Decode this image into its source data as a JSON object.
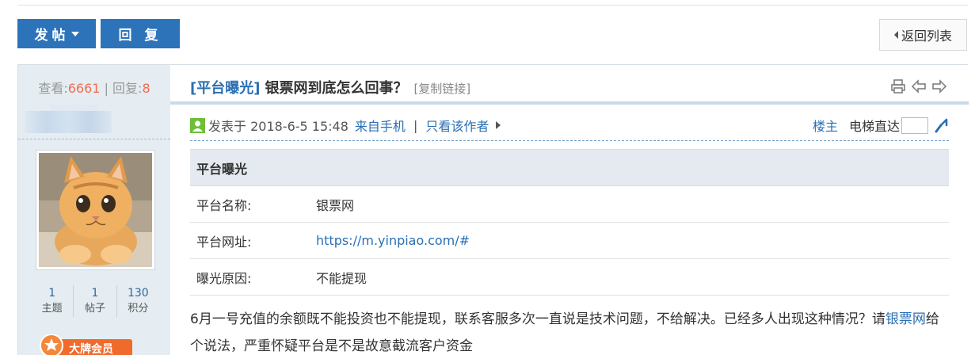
{
  "toolbar": {
    "post_label": "发帖",
    "reply_label": "回 复",
    "back_label": "返回列表"
  },
  "sidebar": {
    "views_label": "查看:",
    "views_value": "6661",
    "divider": "|",
    "replies_label": "回复:",
    "replies_value": "8",
    "counts": [
      {
        "value": "1",
        "label": "主题"
      },
      {
        "value": "1",
        "label": "帖子"
      },
      {
        "value": "130",
        "label": "积分"
      }
    ],
    "badge_label": "大牌会员"
  },
  "post": {
    "title_type": "[平台曝光]",
    "title_text": "银票网到底怎么回事？",
    "copy_link": "[复制链接]",
    "posted_prefix": "发表于 2018-6-5 15:48",
    "from_mobile": "来自手机",
    "separator": "|",
    "only_author": "只看该作者",
    "floor_label": "楼主",
    "elevator_label": "电梯直达",
    "table": {
      "header": "平台曝光",
      "rows": [
        {
          "key": "平台名称:",
          "value": "银票网"
        },
        {
          "key": "平台网址:",
          "value": "https://m.yinpiao.com/#"
        },
        {
          "key": "曝光原因:",
          "value": "不能提现"
        }
      ]
    },
    "body_part1": "6月一号充值的余额既不能投资也不能提现，联系客服多次一直说是技术问题，不给解决。已经多人出现这种情况？请",
    "body_link": "银票网",
    "body_part2": "给个说法，严重怀疑平台是不是故意截流客户资金"
  },
  "colors": {
    "primary_button": "#2d73b9",
    "link": "#2a6fb4",
    "stat_number": "#f26c4f",
    "sidebar_bg": "#e5edf2",
    "badge": "#f06a2b"
  },
  "icons": {
    "print": "print-icon",
    "prev": "prev-thread-icon",
    "next": "next-thread-icon",
    "online": "online-user-icon",
    "jump": "jump-icon"
  }
}
